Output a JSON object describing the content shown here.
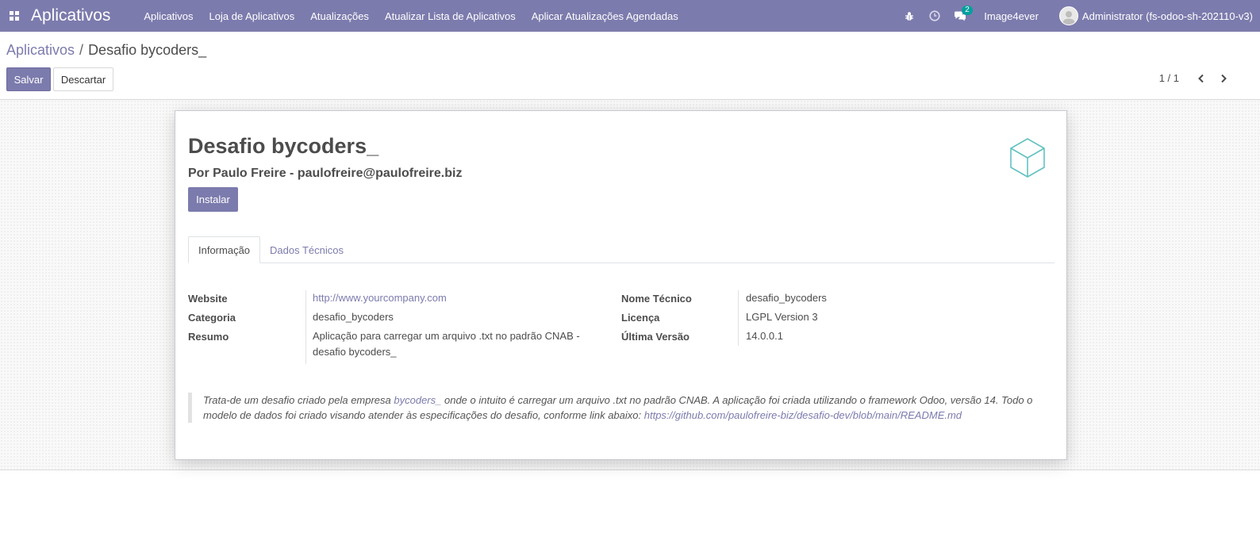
{
  "navbar": {
    "brand": "Aplicativos",
    "menu": [
      {
        "label": "Aplicativos"
      },
      {
        "label": "Loja de Aplicativos"
      },
      {
        "label": "Atualizações"
      },
      {
        "label": "Atualizar Lista de Aplicativos"
      },
      {
        "label": "Aplicar Atualizações Agendadas"
      }
    ],
    "messages_count": "2",
    "company": "Image4ever",
    "user": "Administrator (fs-odoo-sh-202110-v3)",
    "icons": [
      "apps-icon",
      "bug-icon",
      "clock-icon",
      "chat-icon",
      "avatar"
    ]
  },
  "control_panel": {
    "breadcrumb_parent": "Aplicativos",
    "breadcrumb_separator": "/",
    "breadcrumb_current": "Desafio bycoders_",
    "save_label": "Salvar",
    "discard_label": "Descartar",
    "pager": "1 / 1"
  },
  "module": {
    "title": "Desafio bycoders_",
    "author": "Por Paulo Freire - paulofreire@paulofreire.biz",
    "install_label": "Instalar",
    "icon": "cube-icon"
  },
  "tabs": [
    {
      "label": "Informação",
      "active": true
    },
    {
      "label": "Dados Técnicos",
      "active": false
    }
  ],
  "fields_left": [
    {
      "label": "Website",
      "value": "http://www.yourcompany.com"
    },
    {
      "label": "Categoria",
      "value": "desafio_bycoders"
    },
    {
      "label": "Resumo",
      "value": "Aplicação para carregar um arquivo .txt no padrão CNAB - desafio bycoders_"
    }
  ],
  "fields_right": [
    {
      "label": "Nome Técnico",
      "value": "desafio_bycoders"
    },
    {
      "label": "Licença",
      "value": "LGPL Version 3"
    },
    {
      "label": "Última Versão",
      "value": "14.0.0.1"
    }
  ],
  "description": {
    "part1": "Trata-de um desafio criado pela empresa ",
    "link1": "bycoders_",
    "part2": " onde o intuito é carregar um arquivo .txt no padrão CNAB. A aplicação foi criada utilizando o framework Odoo, versão 14. Todo o modelo de dados foi criado visando atender às especificações do desafio, conforme link abaixo: ",
    "link2": "https://github.com/paulofreire-biz/desafio-dev/blob/main/README.md"
  },
  "colors": {
    "brand": "#7c7bad",
    "badge": "#00a09d",
    "module_icon": "#63c2c1"
  }
}
